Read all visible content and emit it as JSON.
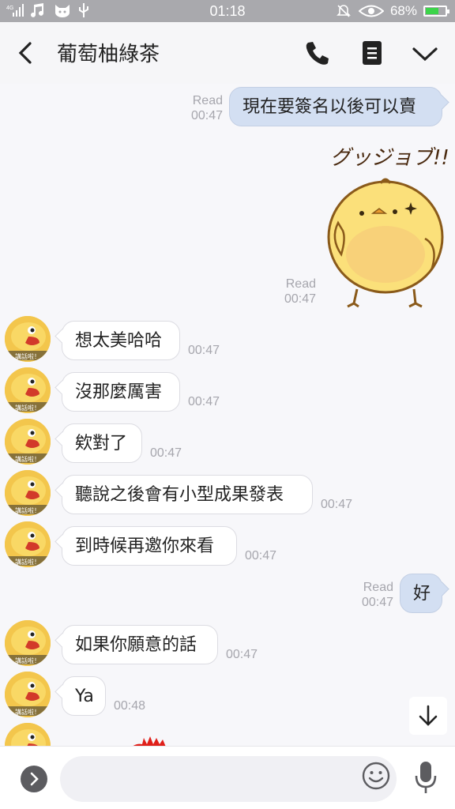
{
  "status_bar": {
    "network": "4G",
    "time": "01:18",
    "battery_percent": "68%",
    "battery_level": 0.68,
    "icons": [
      "signal-icon",
      "music-icon",
      "cat-icon",
      "usb-icon",
      "silent-icon",
      "eye-icon",
      "battery-icon"
    ]
  },
  "header": {
    "title": "葡萄柚綠茶",
    "icons": [
      "back-arrow-icon",
      "phone-icon",
      "notes-icon",
      "chevron-down-icon"
    ]
  },
  "messages": [
    {
      "id": "m1",
      "side": "mine",
      "text": "現在要簽名以後可以賣",
      "status": "Read",
      "time": "00:47"
    },
    {
      "id": "m2",
      "side": "mine",
      "sticker": "sticker-chick-good-job",
      "sticker_text": "グッジョブ!!",
      "status": "Read",
      "time": "00:47"
    },
    {
      "id": "m3",
      "side": "theirs",
      "text": "想太美哈哈",
      "time": "00:47"
    },
    {
      "id": "m4",
      "side": "theirs",
      "text": "沒那麼厲害",
      "time": "00:47"
    },
    {
      "id": "m5",
      "side": "theirs",
      "text": "欸對了",
      "time": "00:47"
    },
    {
      "id": "m6",
      "side": "theirs",
      "text": "聽說之後會有小型成果發表",
      "time": "00:47"
    },
    {
      "id": "m7",
      "side": "theirs",
      "text": "到時候再邀你來看",
      "time": "00:47"
    },
    {
      "id": "m8",
      "side": "mine",
      "text": "好",
      "status": "Read",
      "time": "00:47"
    },
    {
      "id": "m9",
      "side": "theirs",
      "text": "如果你願意的話",
      "time": "00:47"
    },
    {
      "id": "m10",
      "side": "theirs",
      "text": "Ya",
      "time": "00:48"
    }
  ],
  "avatar_label": "講話啦！",
  "input": {
    "placeholder": "",
    "value": ""
  },
  "colors": {
    "status_bar_bg": "#a9a9ad",
    "my_bubble": "#d3dff2",
    "their_bubble": "#ffffff",
    "meta_text": "#a6a6ad",
    "chat_bg": "#f7f7fa"
  }
}
